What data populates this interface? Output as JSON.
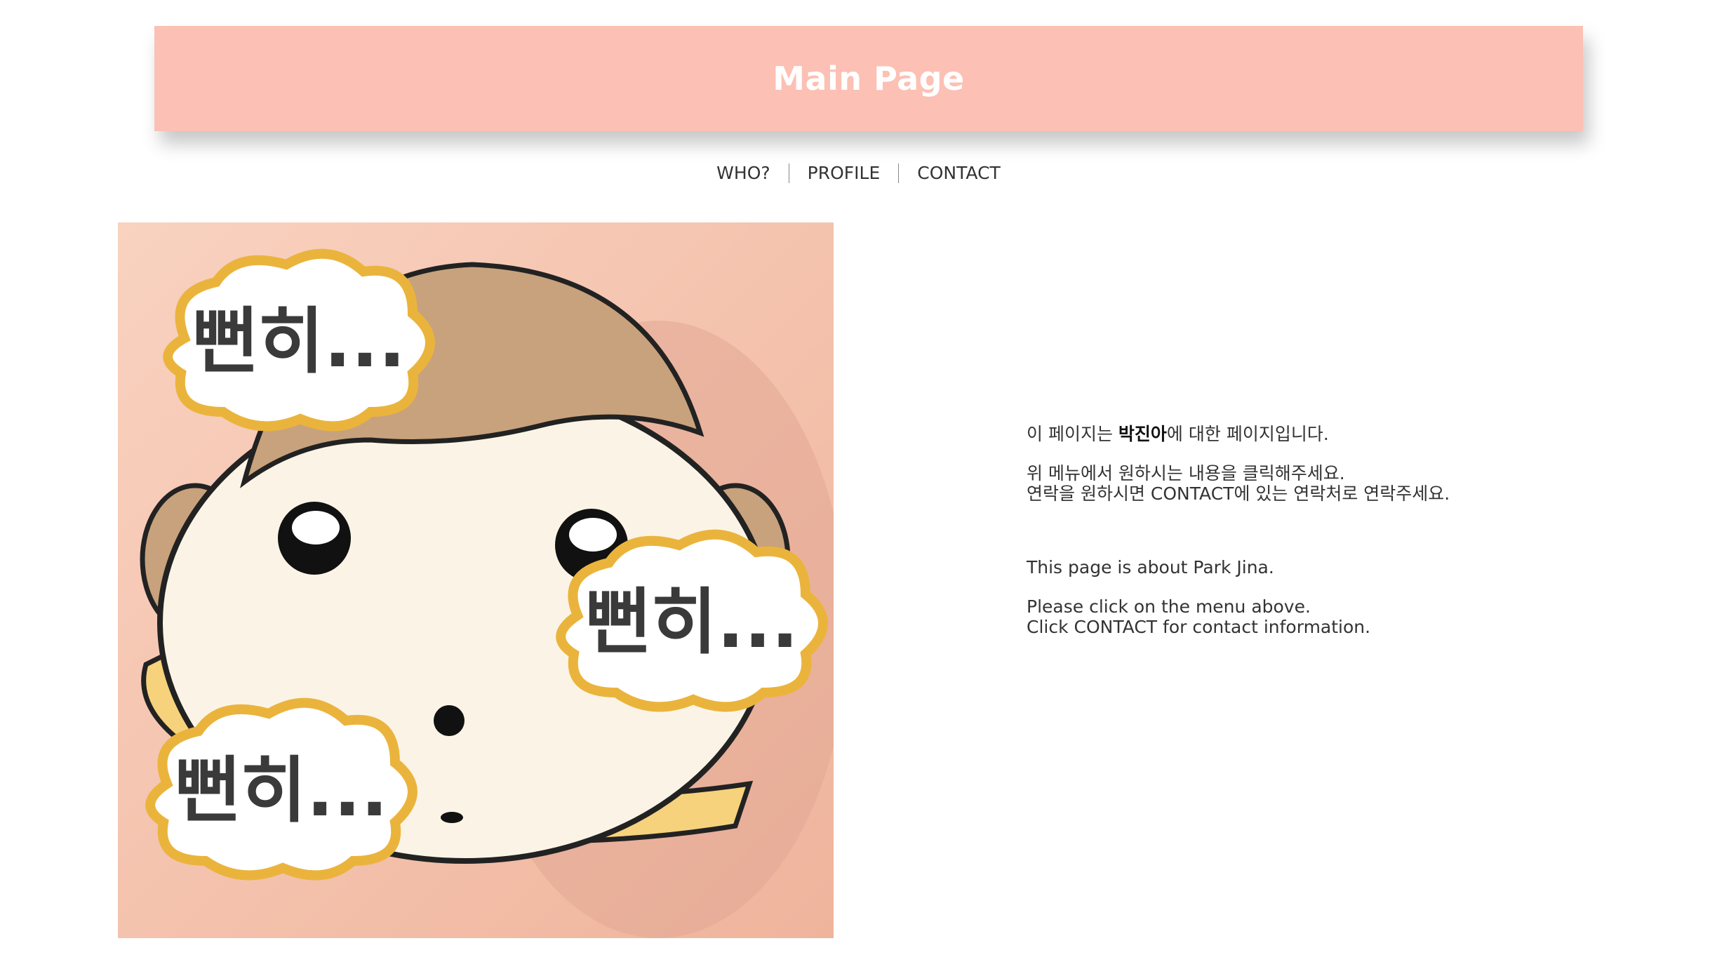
{
  "header": {
    "title": "Main Page"
  },
  "nav": {
    "items": [
      {
        "label": "WHO?"
      },
      {
        "label": "PROFILE"
      },
      {
        "label": "CONTACT"
      }
    ]
  },
  "hero": {
    "bubble_text": "뻔히..."
  },
  "info": {
    "ko_line1_before": "이 페이지는 ",
    "ko_line1_name": "박진아",
    "ko_line1_after": "에 대한 페이지입니다.",
    "ko_line2": "위 메뉴에서 원하시는 내용을 클릭해주세요.",
    "ko_line3": "연락을 원하시면 CONTACT에 있는 연락처로 연락주세요.",
    "en_line1": "This page is about Park Jina.",
    "en_line2": "Please click on the menu above.",
    "en_line3": "Click CONTACT for contact information."
  },
  "colors": {
    "header_bg": "#fcc0b4",
    "header_text": "#ffffff",
    "hero_bg": "#f5c8b4"
  }
}
